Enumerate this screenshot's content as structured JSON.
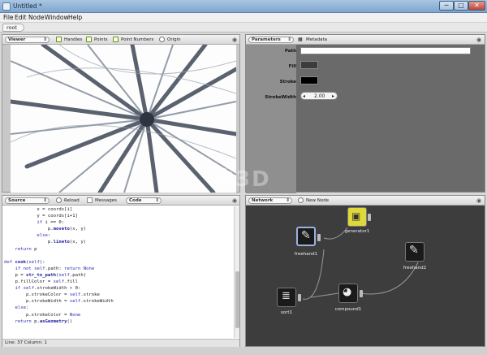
{
  "window": {
    "title": "Untitled *",
    "min_glyph": "─",
    "max_glyph": "□",
    "close_glyph": "✕"
  },
  "menu": [
    "File",
    "Edit",
    "Node",
    "Window",
    "Help"
  ],
  "breadcrumb": {
    "root": "root"
  },
  "viewer": {
    "pane_label": "Viewer",
    "options": [
      {
        "label": "Handles",
        "checked": true
      },
      {
        "label": "Points",
        "checked": true
      },
      {
        "label": "Point Numbers",
        "checked": true
      },
      {
        "label": "Origin",
        "checked": false
      }
    ]
  },
  "parameters": {
    "pane_label": "Parameters",
    "metadata_label": "Metadata",
    "fields": [
      {
        "label": "Path",
        "type": "text",
        "value": ""
      },
      {
        "label": "Fill",
        "type": "color",
        "color": "#3c3c3c"
      },
      {
        "label": "Stroke",
        "type": "color",
        "color": "#000000"
      },
      {
        "label": "StrokeWidth",
        "type": "number",
        "value": "2.00"
      }
    ]
  },
  "source": {
    "pane_label": "Source",
    "reload_label": "Reload",
    "messages_label": "Messages",
    "code_label": "Code",
    "code_lines": [
      "            x = coords[i]",
      "            y = coords[i+1]",
      "            if i == 0:",
      "                p.moveto(x, y)",
      "            else:",
      "                p.lineto(x, y)",
      "    return p",
      "",
      "def cook(self):",
      "    if not self.path: return None",
      "    p = str_to_path(self.path)",
      "    p.fillColor = self.fill",
      "    if self.strokeWidth > 0:",
      "        p.strokeColor = self.stroke",
      "        p.strokeWidth = self.strokeWidth",
      "    else:",
      "        p.strokeColor = None",
      "    return p.asGeometry()"
    ],
    "status": "Line: 37 Column: 1"
  },
  "network": {
    "pane_label": "Network",
    "new_node_label": "New Node",
    "nodes": [
      {
        "id": "generator1",
        "label": "generator1",
        "icon": "generator-icon"
      },
      {
        "id": "freehand1",
        "label": "freehand1",
        "icon": "pen-icon",
        "selected": true
      },
      {
        "id": "freehand2",
        "label": "freehand2",
        "icon": "pen-icon"
      },
      {
        "id": "compound1",
        "label": "compound1",
        "icon": "compound-icon"
      },
      {
        "id": "sort1",
        "label": "sort1",
        "icon": "sort-icon"
      }
    ]
  },
  "watermark": "迪3D",
  "colors": {
    "accent": "#9ab0e0",
    "network_bg": "#3d3d3d",
    "title_bar": "#8fb0d4"
  }
}
